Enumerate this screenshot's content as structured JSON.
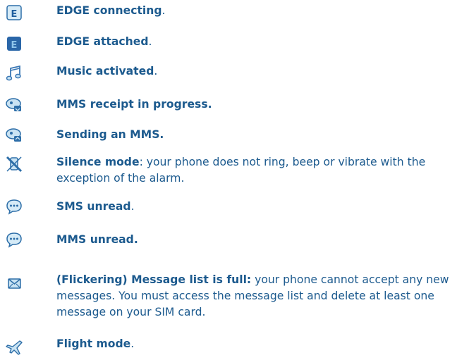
{
  "items": [
    {
      "icon": "edge-connecting-icon",
      "bold": "EDGE connecting",
      "rest": "."
    },
    {
      "icon": "edge-attached-icon",
      "bold": "EDGE attached",
      "rest": "."
    },
    {
      "icon": "music-note-icon",
      "bold": "Music activated",
      "rest": "."
    },
    {
      "icon": "mms-receiving-icon",
      "bold": "MMS receipt in progress.",
      "rest": ""
    },
    {
      "icon": "mms-sending-icon",
      "bold": "Sending an MMS.",
      "rest": ""
    },
    {
      "icon": "silence-mode-icon",
      "bold": "Silence mode",
      "rest": ": your phone does not ring, beep or vibrate with the exception of the alarm."
    },
    {
      "icon": "sms-unread-icon",
      "bold": "SMS unread",
      "rest": "."
    },
    {
      "icon": "mms-unread-icon",
      "bold": "MMS unread.",
      "rest": ""
    },
    {
      "icon": "message-list-full-icon",
      "bold": "(Flickering) Message list is full:",
      "rest": " your phone cannot accept any new messages. You must access the message list and delete at least one message on your SIM card."
    },
    {
      "icon": "flight-mode-icon",
      "bold": "Flight mode",
      "rest": "."
    }
  ],
  "colors": {
    "text": "#1c5a8e",
    "icon_light": "#c9e3f3",
    "icon_dark": "#1f5f9e"
  }
}
